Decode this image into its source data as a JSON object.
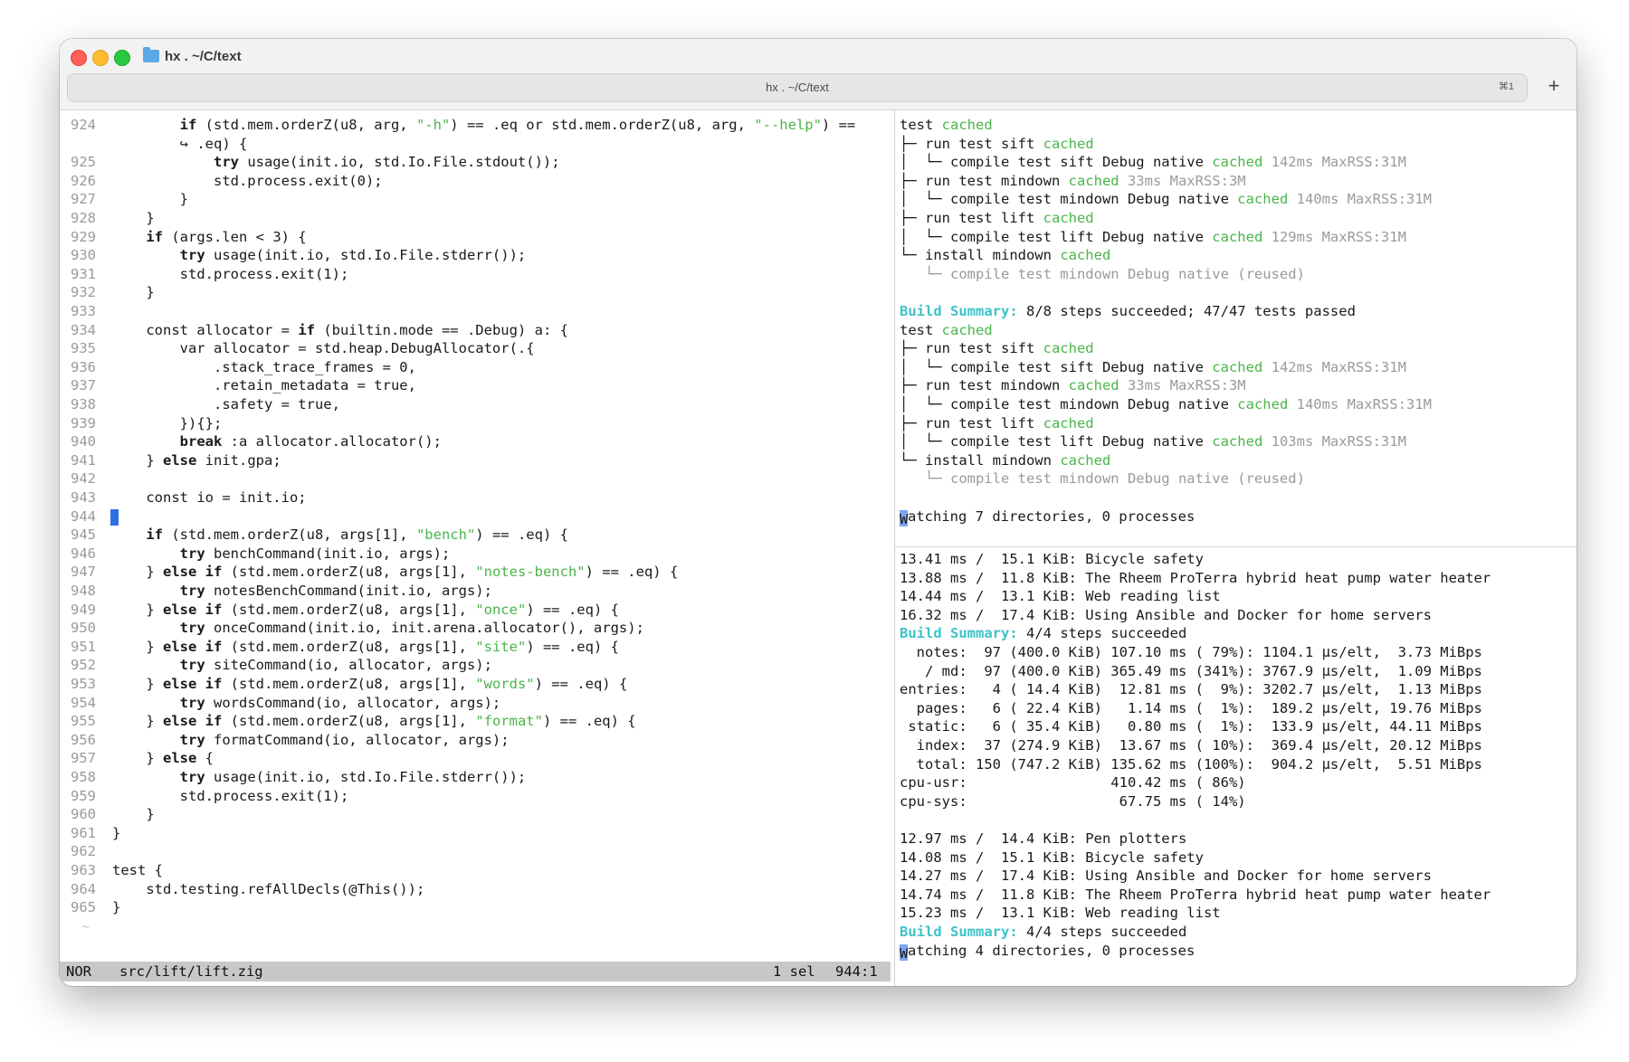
{
  "window": {
    "title": "hx . ~/C/text",
    "tab_label": "hx . ~/C/text",
    "tab_shortcut": "⌘1",
    "new_tab_label": "+"
  },
  "editor": {
    "code_lines": [
      {
        "n": "924",
        "t": "        if (std.mem.orderZ(u8, arg, \"-h\") == .eq or std.mem.orderZ(u8, arg, \"--help\") =="
      },
      {
        "n": "",
        "t": "        ↪ .eq) {"
      },
      {
        "n": "925",
        "t": "            try usage(init.io, std.Io.File.stdout());"
      },
      {
        "n": "926",
        "t": "            std.process.exit(0);"
      },
      {
        "n": "927",
        "t": "        }"
      },
      {
        "n": "928",
        "t": "    }"
      },
      {
        "n": "929",
        "t": "    if (args.len < 3) {"
      },
      {
        "n": "930",
        "t": "        try usage(init.io, std.Io.File.stderr());"
      },
      {
        "n": "931",
        "t": "        std.process.exit(1);"
      },
      {
        "n": "932",
        "t": "    }"
      },
      {
        "n": "933",
        "t": ""
      },
      {
        "n": "934",
        "t": "    const allocator = if (builtin.mode == .Debug) a: {"
      },
      {
        "n": "935",
        "t": "        var allocator = std.heap.DebugAllocator(.{"
      },
      {
        "n": "936",
        "t": "            .stack_trace_frames = 0,"
      },
      {
        "n": "937",
        "t": "            .retain_metadata = true,"
      },
      {
        "n": "938",
        "t": "            .safety = true,"
      },
      {
        "n": "939",
        "t": "        }){};"
      },
      {
        "n": "940",
        "t": "        break :a allocator.allocator();"
      },
      {
        "n": "941",
        "t": "    } else init.gpa;"
      },
      {
        "n": "942",
        "t": ""
      },
      {
        "n": "943",
        "t": "    const io = init.io;"
      },
      {
        "n": "944",
        "t": ""
      },
      {
        "n": "945",
        "t": "    if (std.mem.orderZ(u8, args[1], \"bench\") == .eq) {"
      },
      {
        "n": "946",
        "t": "        try benchCommand(init.io, args);"
      },
      {
        "n": "947",
        "t": "    } else if (std.mem.orderZ(u8, args[1], \"notes-bench\") == .eq) {"
      },
      {
        "n": "948",
        "t": "        try notesBenchCommand(init.io, args);"
      },
      {
        "n": "949",
        "t": "    } else if (std.mem.orderZ(u8, args[1], \"once\") == .eq) {"
      },
      {
        "n": "950",
        "t": "        try onceCommand(init.io, init.arena.allocator(), args);"
      },
      {
        "n": "951",
        "t": "    } else if (std.mem.orderZ(u8, args[1], \"site\") == .eq) {"
      },
      {
        "n": "952",
        "t": "        try siteCommand(io, allocator, args);"
      },
      {
        "n": "953",
        "t": "    } else if (std.mem.orderZ(u8, args[1], \"words\") == .eq) {"
      },
      {
        "n": "954",
        "t": "        try wordsCommand(io, allocator, args);"
      },
      {
        "n": "955",
        "t": "    } else if (std.mem.orderZ(u8, args[1], \"format\") == .eq) {"
      },
      {
        "n": "956",
        "t": "        try formatCommand(io, allocator, args);"
      },
      {
        "n": "957",
        "t": "    } else {"
      },
      {
        "n": "958",
        "t": "        try usage(init.io, std.Io.File.stderr());"
      },
      {
        "n": "959",
        "t": "        std.process.exit(1);"
      },
      {
        "n": "960",
        "t": "    }"
      },
      {
        "n": "961",
        "t": "}"
      },
      {
        "n": "962",
        "t": ""
      },
      {
        "n": "963",
        "t": "test {"
      },
      {
        "n": "964",
        "t": "    std.testing.refAllDecls(@This());"
      },
      {
        "n": "965",
        "t": "}"
      }
    ],
    "tilde": "~",
    "status": {
      "mode": "NOR",
      "file": "src/lift/lift.zig",
      "selection": "1 sel",
      "position": "944:1"
    }
  },
  "terminal_top": {
    "lines": [
      [
        {
          "t": "test "
        },
        {
          "t": "cached",
          "c": "ok"
        }
      ],
      [
        {
          "t": "├─ run test sift "
        },
        {
          "t": "cached",
          "c": "ok"
        }
      ],
      [
        {
          "t": "│  └─ compile test sift Debug native "
        },
        {
          "t": "cached",
          "c": "ok"
        },
        {
          "t": " 142ms MaxRSS:31M",
          "c": "dim"
        }
      ],
      [
        {
          "t": "├─ run test mindown "
        },
        {
          "t": "cached",
          "c": "ok"
        },
        {
          "t": " 33ms MaxRSS:3M",
          "c": "dim"
        }
      ],
      [
        {
          "t": "│  └─ compile test mindown Debug native "
        },
        {
          "t": "cached",
          "c": "ok"
        },
        {
          "t": " 140ms MaxRSS:31M",
          "c": "dim"
        }
      ],
      [
        {
          "t": "├─ run test lift "
        },
        {
          "t": "cached",
          "c": "ok"
        }
      ],
      [
        {
          "t": "│  └─ compile test lift Debug native "
        },
        {
          "t": "cached",
          "c": "ok"
        },
        {
          "t": " 129ms MaxRSS:31M",
          "c": "dim"
        }
      ],
      [
        {
          "t": "└─ install mindown "
        },
        {
          "t": "cached",
          "c": "ok"
        }
      ],
      [
        {
          "t": "   └─ compile test mindown Debug native (reused)",
          "c": "dim"
        }
      ],
      [
        {
          "t": ""
        }
      ],
      [
        {
          "t": "Build Summary:",
          "c": "bs"
        },
        {
          "t": " 8/8 steps succeeded; 47/47 tests passed"
        }
      ],
      [
        {
          "t": "test "
        },
        {
          "t": "cached",
          "c": "ok"
        }
      ],
      [
        {
          "t": "├─ run test sift "
        },
        {
          "t": "cached",
          "c": "ok"
        }
      ],
      [
        {
          "t": "│  └─ compile test sift Debug native "
        },
        {
          "t": "cached",
          "c": "ok"
        },
        {
          "t": " 142ms MaxRSS:31M",
          "c": "dim"
        }
      ],
      [
        {
          "t": "├─ run test mindown "
        },
        {
          "t": "cached",
          "c": "ok"
        },
        {
          "t": " 33ms MaxRSS:3M",
          "c": "dim"
        }
      ],
      [
        {
          "t": "│  └─ compile test mindown Debug native "
        },
        {
          "t": "cached",
          "c": "ok"
        },
        {
          "t": " 140ms MaxRSS:31M",
          "c": "dim"
        }
      ],
      [
        {
          "t": "├─ run test lift "
        },
        {
          "t": "cached",
          "c": "ok"
        }
      ],
      [
        {
          "t": "│  └─ compile test lift Debug native "
        },
        {
          "t": "cached",
          "c": "ok"
        },
        {
          "t": " 103ms MaxRSS:31M",
          "c": "dim"
        }
      ],
      [
        {
          "t": "└─ install mindown "
        },
        {
          "t": "cached",
          "c": "ok"
        }
      ],
      [
        {
          "t": "   └─ compile test mindown Debug native (reused)",
          "c": "dim"
        }
      ],
      [
        {
          "t": ""
        }
      ],
      [
        {
          "t": "W",
          "c": "cursor"
        },
        {
          "t": "atching 7 directories, 0 processes"
        }
      ]
    ]
  },
  "terminal_bottom": {
    "lines": [
      [
        {
          "t": "13.41 ms /  15.1 KiB: Bicycle safety"
        }
      ],
      [
        {
          "t": "13.88 ms /  11.8 KiB: The Rheem ProTerra hybrid heat pump water heater"
        }
      ],
      [
        {
          "t": "14.44 ms /  13.1 KiB: Web reading list"
        }
      ],
      [
        {
          "t": "16.32 ms /  17.4 KiB: Using Ansible and Docker for home servers"
        }
      ],
      [
        {
          "t": "Build Summary:",
          "c": "bs"
        },
        {
          "t": " 4/4 steps succeeded"
        }
      ],
      [
        {
          "t": "  notes:  97 (400.0 KiB) 107.10 ms ( 79%): 1104.1 μs/elt,  3.73 MiBps"
        }
      ],
      [
        {
          "t": "   / md:  97 (400.0 KiB) 365.49 ms (341%): 3767.9 μs/elt,  1.09 MiBps"
        }
      ],
      [
        {
          "t": "entries:   4 ( 14.4 KiB)  12.81 ms (  9%): 3202.7 μs/elt,  1.13 MiBps"
        }
      ],
      [
        {
          "t": "  pages:   6 ( 22.4 KiB)   1.14 ms (  1%):  189.2 μs/elt, 19.76 MiBps"
        }
      ],
      [
        {
          "t": " static:   6 ( 35.4 KiB)   0.80 ms (  1%):  133.9 μs/elt, 44.11 MiBps"
        }
      ],
      [
        {
          "t": "  index:  37 (274.9 KiB)  13.67 ms ( 10%):  369.4 μs/elt, 20.12 MiBps"
        }
      ],
      [
        {
          "t": "  total: 150 (747.2 KiB) 135.62 ms (100%):  904.2 μs/elt,  5.51 MiBps"
        }
      ],
      [
        {
          "t": "cpu-usr:                 410.42 ms ( 86%)"
        }
      ],
      [
        {
          "t": "cpu-sys:                  67.75 ms ( 14%)"
        }
      ],
      [
        {
          "t": ""
        }
      ],
      [
        {
          "t": "12.97 ms /  14.4 KiB: Pen plotters"
        }
      ],
      [
        {
          "t": "14.08 ms /  15.1 KiB: Bicycle safety"
        }
      ],
      [
        {
          "t": "14.27 ms /  17.4 KiB: Using Ansible and Docker for home servers"
        }
      ],
      [
        {
          "t": "14.74 ms /  11.8 KiB: The Rheem ProTerra hybrid heat pump water heater"
        }
      ],
      [
        {
          "t": "15.23 ms /  13.1 KiB: Web reading list"
        }
      ],
      [
        {
          "t": "Build Summary:",
          "c": "bs"
        },
        {
          "t": " 4/4 steps succeeded"
        }
      ],
      [
        {
          "t": "W",
          "c": "cursor"
        },
        {
          "t": "atching 4 directories, 0 processes"
        }
      ]
    ]
  },
  "colors": {
    "ok_green": "#4ab54a",
    "summary_cyan": "#3ec3c8",
    "cursor_blue": "#2f6fe4",
    "keyword": "#1a1a1a",
    "string_green": "#4ab54a"
  }
}
